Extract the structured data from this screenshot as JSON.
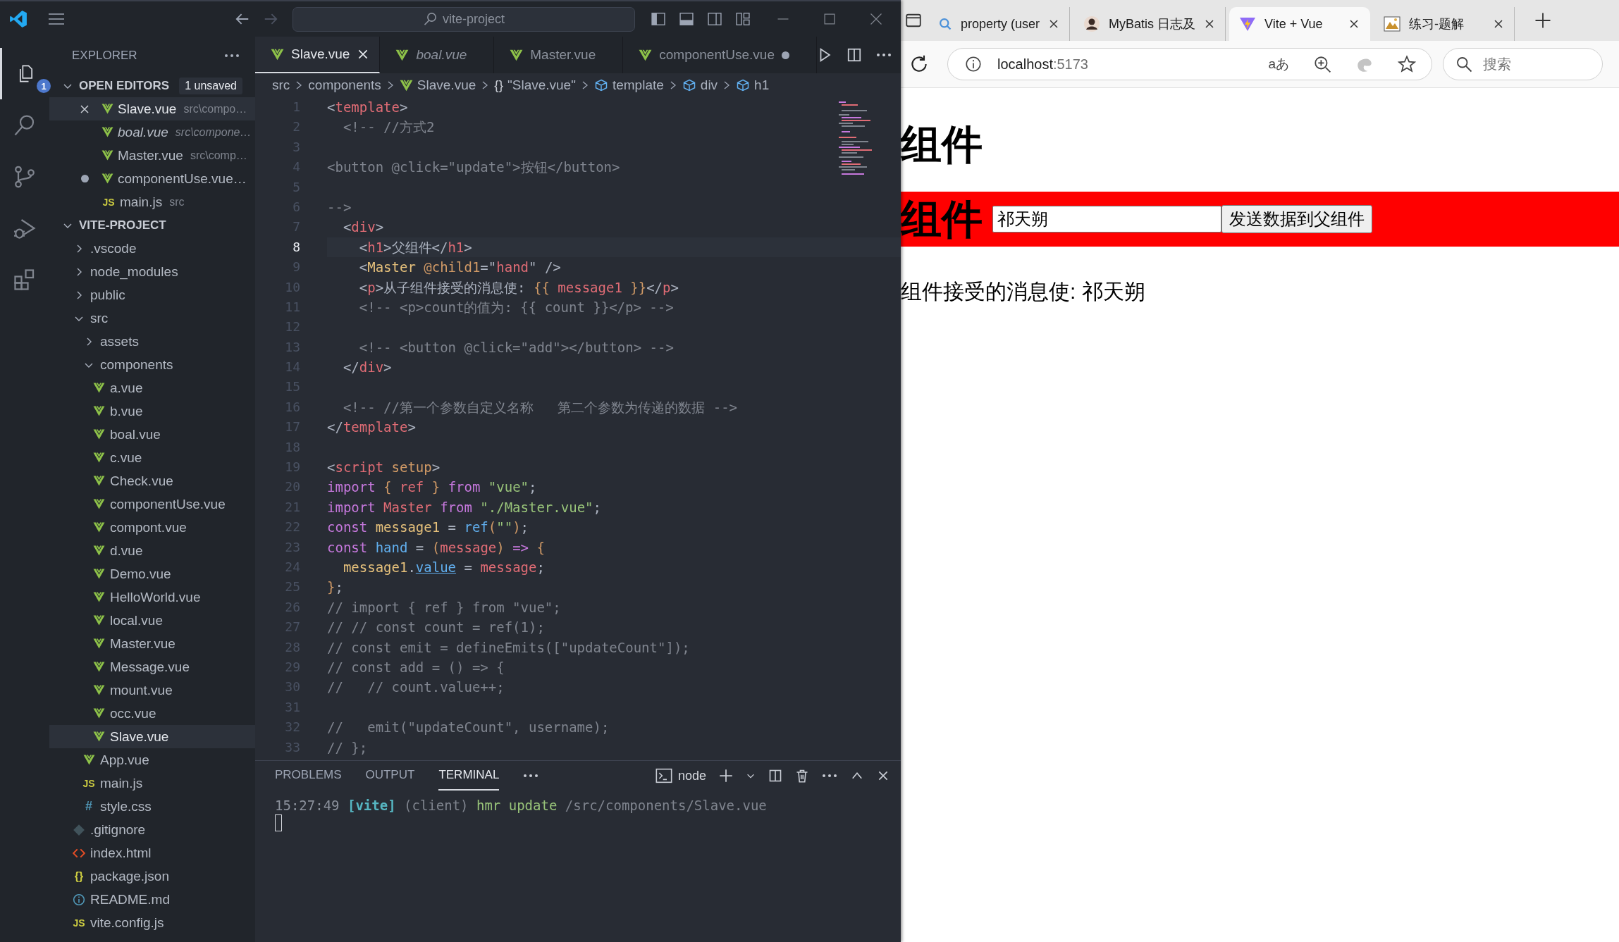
{
  "titlebar": {
    "search": "vite-project"
  },
  "activity_bar": [
    {
      "kind": "explorer",
      "selected": true,
      "badge": "1"
    },
    {
      "kind": "search",
      "selected": false
    },
    {
      "kind": "source-control",
      "selected": false
    },
    {
      "kind": "run-debug",
      "selected": false
    },
    {
      "kind": "extensions",
      "selected": false
    }
  ],
  "sidebar": {
    "title": "EXPLORER",
    "open_editors": {
      "label": "OPEN EDITORS",
      "badge": "1 unsaved",
      "expanded": true,
      "items": [
        {
          "name": "Slave.vue",
          "path": "src\\compo…",
          "kind": "vue",
          "selected": true,
          "preview": false,
          "dirty": false
        },
        {
          "name": "boal.vue",
          "path": "src\\compone…",
          "kind": "vue",
          "selected": false,
          "preview": true,
          "dirty": false
        },
        {
          "name": "Master.vue",
          "path": "src\\comp…",
          "kind": "vue",
          "selected": false,
          "preview": false,
          "dirty": false
        },
        {
          "name": "componentUse.vue…",
          "kind": "vue",
          "selected": false,
          "preview": false,
          "dirty": true
        },
        {
          "name": "main.js",
          "path": "src",
          "kind": "js",
          "glyph": "JS",
          "selected": false,
          "preview": false,
          "dirty": false
        }
      ]
    },
    "project": {
      "label": "VITE-PROJECT",
      "expanded": true,
      "tree": [
        {
          "name": ".vscode",
          "kind": "folder",
          "expanded": false,
          "selected": false
        },
        {
          "name": "node_modules",
          "kind": "folder",
          "expanded": false,
          "selected": false
        },
        {
          "name": "public",
          "kind": "folder",
          "expanded": false,
          "selected": false
        },
        {
          "name": "src",
          "kind": "folder",
          "expanded": true,
          "selected": false,
          "children": [
            {
              "name": "assets",
              "kind": "folder",
              "expanded": false,
              "selected": false
            },
            {
              "name": "components",
              "kind": "folder",
              "expanded": true,
              "selected": false,
              "children": [
                {
                  "name": "a.vue",
                  "kind": "vue",
                  "selected": false
                },
                {
                  "name": "b.vue",
                  "kind": "vue",
                  "selected": false
                },
                {
                  "name": "boal.vue",
                  "kind": "vue",
                  "selected": false
                },
                {
                  "name": "c.vue",
                  "kind": "vue",
                  "selected": false
                },
                {
                  "name": "Check.vue",
                  "kind": "vue",
                  "selected": false
                },
                {
                  "name": "componentUse.vue",
                  "kind": "vue",
                  "selected": false
                },
                {
                  "name": "compont.vue",
                  "kind": "vue",
                  "selected": false
                },
                {
                  "name": "d.vue",
                  "kind": "vue",
                  "selected": false
                },
                {
                  "name": "Demo.vue",
                  "kind": "vue",
                  "selected": false
                },
                {
                  "name": "HelloWorld.vue",
                  "kind": "vue",
                  "selected": false
                },
                {
                  "name": "local.vue",
                  "kind": "vue",
                  "selected": false
                },
                {
                  "name": "Master.vue",
                  "kind": "vue",
                  "selected": false
                },
                {
                  "name": "Message.vue",
                  "kind": "vue",
                  "selected": false
                },
                {
                  "name": "mount.vue",
                  "kind": "vue",
                  "selected": false
                },
                {
                  "name": "occ.vue",
                  "kind": "vue",
                  "selected": false
                },
                {
                  "name": "Slave.vue",
                  "kind": "vue",
                  "selected": true
                }
              ]
            },
            {
              "name": "App.vue",
              "kind": "vue",
              "selected": false
            },
            {
              "name": "main.js",
              "kind": "js",
              "glyph": "JS",
              "selected": false
            },
            {
              "name": "style.css",
              "kind": "css",
              "glyph": "#",
              "selected": false
            }
          ]
        },
        {
          "name": ".gitignore",
          "kind": "git",
          "selected": false
        },
        {
          "name": "index.html",
          "kind": "html",
          "selected": false
        },
        {
          "name": "package.json",
          "kind": "json",
          "glyph": "{}",
          "selected": false
        },
        {
          "name": "README.md",
          "kind": "info",
          "selected": false
        },
        {
          "name": "vite.config.js",
          "kind": "js",
          "glyph": "JS",
          "selected": false
        }
      ]
    }
  },
  "editor": {
    "tabs": [
      {
        "label": "Slave.vue",
        "kind": "vue",
        "selected": true,
        "preview": false,
        "dirty": false
      },
      {
        "label": "boal.vue",
        "kind": "vue",
        "selected": false,
        "preview": true,
        "dirty": false
      },
      {
        "label": "Master.vue",
        "kind": "vue",
        "selected": false,
        "preview": false,
        "dirty": false
      },
      {
        "label": "componentUse.vue",
        "kind": "vue",
        "selected": false,
        "preview": false,
        "dirty": true
      }
    ],
    "breadcrumb": [
      {
        "label": "src",
        "kind": "text"
      },
      {
        "label": "components",
        "kind": "text"
      },
      {
        "label": "Slave.vue",
        "kind": "vue"
      },
      {
        "label": "\"Slave.vue\"",
        "kind": "object",
        "glyph": "{}"
      },
      {
        "label": "template",
        "kind": "element"
      },
      {
        "label": "div",
        "kind": "element"
      },
      {
        "label": "h1",
        "kind": "element"
      }
    ],
    "lines": [
      {
        "n": "1",
        "current": false,
        "tokens": [
          {
            "text": "<",
            "kind": "p"
          },
          {
            "text": "template",
            "kind": "tag"
          },
          {
            "text": ">",
            "kind": "p"
          }
        ]
      },
      {
        "n": "2",
        "current": false,
        "tokens": [
          {
            "text": "  <!-- //方式2",
            "kind": "cm"
          }
        ]
      },
      {
        "n": "3",
        "current": false
      },
      {
        "n": "4",
        "current": false,
        "tokens": [
          {
            "text": "<button @click=\"update\">按钮</button>",
            "kind": "cm"
          }
        ]
      },
      {
        "n": "5",
        "current": false
      },
      {
        "n": "6",
        "current": false,
        "tokens": [
          {
            "text": "-->",
            "kind": "cm"
          }
        ]
      },
      {
        "n": "7",
        "current": false,
        "tokens": [
          {
            "text": "  <",
            "kind": "p"
          },
          {
            "text": "div",
            "kind": "tag"
          },
          {
            "text": ">",
            "kind": "p"
          }
        ]
      },
      {
        "n": "8",
        "current": true,
        "tokens": [
          {
            "text": "    <",
            "kind": "p"
          },
          {
            "text": "h1",
            "kind": "tag"
          },
          {
            "text": ">父组件</",
            "kind": "p"
          },
          {
            "text": "h1",
            "kind": "tag"
          },
          {
            "text": ">",
            "kind": "p"
          }
        ]
      },
      {
        "n": "9",
        "current": false,
        "tokens": [
          {
            "text": "    <",
            "kind": "p"
          },
          {
            "text": "Master",
            "kind": "comp"
          },
          {
            "text": " @child1",
            "kind": "attr"
          },
          {
            "text": "=\"",
            "kind": "p"
          },
          {
            "text": "hand",
            "kind": "var"
          },
          {
            "text": "\" />",
            "kind": "p"
          }
        ]
      },
      {
        "n": "10",
        "current": false,
        "tokens": [
          {
            "text": "    <",
            "kind": "p"
          },
          {
            "text": "p",
            "kind": "tag"
          },
          {
            "text": ">从子组件接受的消息使: ",
            "kind": "p"
          },
          {
            "text": "{{",
            "kind": "br"
          },
          {
            "text": " message1 ",
            "kind": "var"
          },
          {
            "text": "}}",
            "kind": "br"
          },
          {
            "text": "</",
            "kind": "p"
          },
          {
            "text": "p",
            "kind": "tag"
          },
          {
            "text": ">",
            "kind": "p"
          }
        ]
      },
      {
        "n": "11",
        "current": false,
        "tokens": [
          {
            "text": "    <!-- <p>count的值为: {{ count }}</p> -->",
            "kind": "cm"
          }
        ]
      },
      {
        "n": "12",
        "current": false
      },
      {
        "n": "13",
        "current": false,
        "tokens": [
          {
            "text": "    <!-- <button @click=\"add\"></button> -->",
            "kind": "cm"
          }
        ]
      },
      {
        "n": "14",
        "current": false,
        "tokens": [
          {
            "text": "  </",
            "kind": "p"
          },
          {
            "text": "div",
            "kind": "tag"
          },
          {
            "text": ">",
            "kind": "p"
          }
        ]
      },
      {
        "n": "15",
        "current": false
      },
      {
        "n": "16",
        "current": false,
        "tokens": [
          {
            "text": "  <!-- //第一个参数自定义名称   第二个参数为传递的数据 -->",
            "kind": "cm"
          }
        ]
      },
      {
        "n": "17",
        "current": false,
        "tokens": [
          {
            "text": "</",
            "kind": "p"
          },
          {
            "text": "template",
            "kind": "tag"
          },
          {
            "text": ">",
            "kind": "p"
          }
        ]
      },
      {
        "n": "18",
        "current": false
      },
      {
        "n": "19",
        "current": false,
        "tokens": [
          {
            "text": "<",
            "kind": "p"
          },
          {
            "text": "script",
            "kind": "tag"
          },
          {
            "text": " setup",
            "kind": "attr"
          },
          {
            "text": ">",
            "kind": "p"
          }
        ]
      },
      {
        "n": "20",
        "current": false,
        "tokens": [
          {
            "text": "import ",
            "kind": "kw"
          },
          {
            "text": "{ ",
            "kind": "br"
          },
          {
            "text": "ref",
            "kind": "var"
          },
          {
            "text": " }",
            "kind": "br"
          },
          {
            "text": " from ",
            "kind": "kw"
          },
          {
            "text": "\"vue\"",
            "kind": "str"
          },
          {
            "text": ";",
            "kind": "p"
          }
        ]
      },
      {
        "n": "21",
        "current": false,
        "tokens": [
          {
            "text": "import ",
            "kind": "kw"
          },
          {
            "text": "Master",
            "kind": "var"
          },
          {
            "text": " from ",
            "kind": "kw"
          },
          {
            "text": "\"./Master.vue\"",
            "kind": "str"
          },
          {
            "text": ";",
            "kind": "p"
          }
        ]
      },
      {
        "n": "22",
        "current": false,
        "tokens": [
          {
            "text": "const ",
            "kind": "kw"
          },
          {
            "text": "message1",
            "kind": "cls"
          },
          {
            "text": " = ",
            "kind": "p"
          },
          {
            "text": "ref",
            "kind": "fn"
          },
          {
            "text": "(",
            "kind": "br"
          },
          {
            "text": "\"\"",
            "kind": "str"
          },
          {
            "text": ")",
            "kind": "br"
          },
          {
            "text": ";",
            "kind": "p"
          }
        ]
      },
      {
        "n": "23",
        "current": false,
        "tokens": [
          {
            "text": "const ",
            "kind": "kw"
          },
          {
            "text": "hand",
            "kind": "fn"
          },
          {
            "text": " = ",
            "kind": "p"
          },
          {
            "text": "(",
            "kind": "br"
          },
          {
            "text": "message",
            "kind": "var"
          },
          {
            "text": ")",
            "kind": "br"
          },
          {
            "text": " => ",
            "kind": "kw"
          },
          {
            "text": "{",
            "kind": "br"
          }
        ]
      },
      {
        "n": "24",
        "current": false,
        "tokens": [
          {
            "text": "  message1",
            "kind": "cls"
          },
          {
            "text": ".",
            "kind": "p"
          },
          {
            "text": "value",
            "kind": "lnk"
          },
          {
            "text": " = ",
            "kind": "p"
          },
          {
            "text": "message",
            "kind": "var"
          },
          {
            "text": ";",
            "kind": "p"
          }
        ]
      },
      {
        "n": "25",
        "current": false,
        "tokens": [
          {
            "text": "}",
            "kind": "br"
          },
          {
            "text": ";",
            "kind": "p"
          }
        ]
      },
      {
        "n": "26",
        "current": false,
        "tokens": [
          {
            "text": "// import { ref } from \"vue\";",
            "kind": "cm"
          }
        ]
      },
      {
        "n": "27",
        "current": false,
        "tokens": [
          {
            "text": "// // const count = ref(1);",
            "kind": "cm"
          }
        ]
      },
      {
        "n": "28",
        "current": false,
        "tokens": [
          {
            "text": "// const emit = defineEmits([\"updateCount\"]);",
            "kind": "cm"
          }
        ]
      },
      {
        "n": "29",
        "current": false,
        "tokens": [
          {
            "text": "// const add = () => {",
            "kind": "cm"
          }
        ]
      },
      {
        "n": "30",
        "current": false,
        "tokens": [
          {
            "text": "//   // count.value++;",
            "kind": "cm"
          }
        ]
      },
      {
        "n": "31",
        "current": false
      },
      {
        "n": "32",
        "current": false,
        "tokens": [
          {
            "text": "//   emit(\"updateCount\", username);",
            "kind": "cm"
          }
        ]
      },
      {
        "n": "33",
        "current": false,
        "tokens": [
          {
            "text": "// };",
            "kind": "cm"
          }
        ]
      }
    ]
  },
  "panel": {
    "tabs": [
      {
        "label": "PROBLEMS",
        "selected": false
      },
      {
        "label": "OUTPUT",
        "selected": false
      },
      {
        "label": "TERMINAL",
        "selected": true
      }
    ],
    "terminal_name": "node",
    "terminal_lines": [
      {
        "tokens": [
          {
            "text": "15:27:49 ",
            "kind": "time"
          },
          {
            "text": "[vite]",
            "kind": "vite"
          },
          {
            "text": " (client) ",
            "kind": "dim"
          },
          {
            "text": "hmr update ",
            "kind": "ok"
          },
          {
            "text": "/src/components/Slave.vue",
            "kind": "dim"
          }
        ]
      }
    ]
  },
  "browser": {
    "tabs": [
      {
        "title": "property (user",
        "kind": "search",
        "selected": false
      },
      {
        "title": "MyBatis 日志及",
        "kind": "avatar",
        "selected": false
      },
      {
        "title": "Vite + Vue",
        "kind": "vite",
        "selected": true
      },
      {
        "title": "练习-题解",
        "kind": "picture",
        "selected": false
      }
    ],
    "address": {
      "host": "localhost",
      "port": ":5173"
    },
    "read_aloud": "aあ",
    "search": {
      "placeholder": "搜索"
    },
    "page": {
      "heading": "组件",
      "banner": {
        "heading": "组件",
        "input": {
          "value": "祁天朔"
        },
        "button": "发送数据到父组件"
      },
      "message": "组件接受的消息使: 祁天朔"
    }
  }
}
